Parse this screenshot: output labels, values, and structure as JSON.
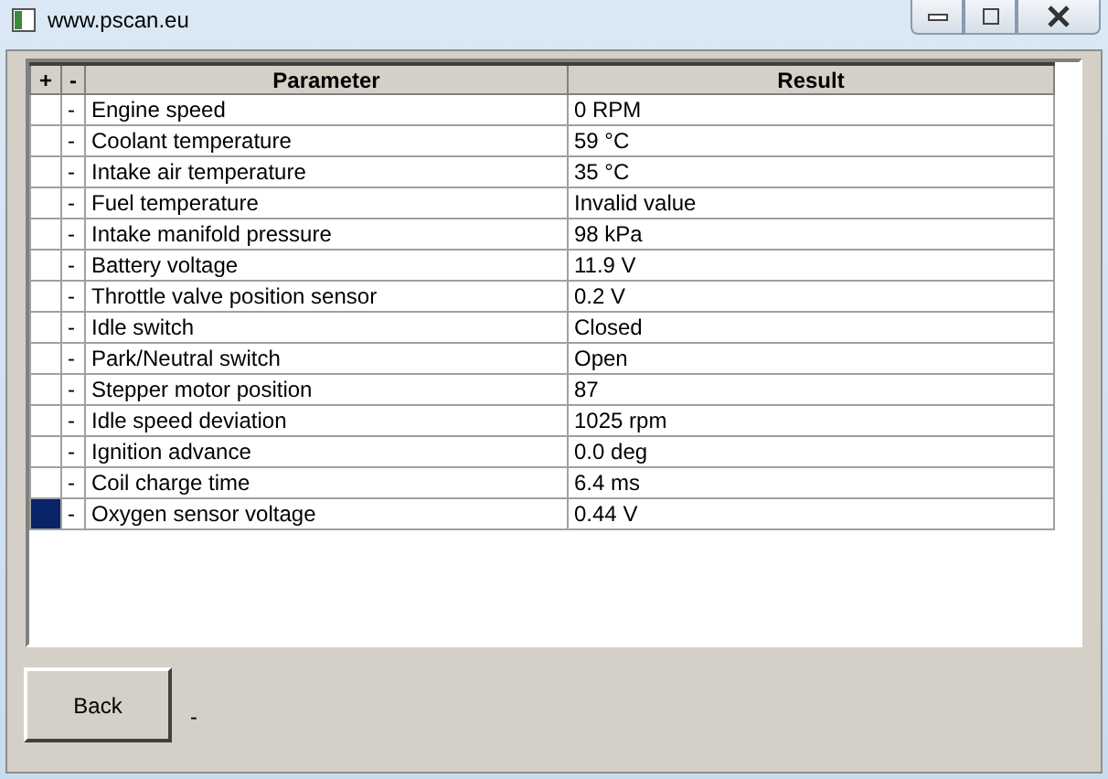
{
  "window": {
    "title": "www.pscan.eu"
  },
  "table": {
    "columns": [
      "+",
      "-",
      "Parameter",
      "Result"
    ],
    "rows": [
      {
        "marker": "-",
        "parameter": "Engine speed",
        "result": "0 RPM",
        "selected": false
      },
      {
        "marker": "-",
        "parameter": "Coolant temperature",
        "result": "59 °C",
        "selected": false
      },
      {
        "marker": "-",
        "parameter": "Intake air temperature",
        "result": "35 °C",
        "selected": false
      },
      {
        "marker": "-",
        "parameter": "Fuel temperature",
        "result": "Invalid value",
        "selected": false
      },
      {
        "marker": "-",
        "parameter": "Intake manifold pressure",
        "result": "98 kPa",
        "selected": false
      },
      {
        "marker": "-",
        "parameter": "Battery voltage",
        "result": "11.9 V",
        "selected": false
      },
      {
        "marker": "-",
        "parameter": "Throttle valve position sensor",
        "result": "0.2 V",
        "selected": false
      },
      {
        "marker": "-",
        "parameter": "Idle switch",
        "result": "Closed",
        "selected": false
      },
      {
        "marker": "-",
        "parameter": "Park/Neutral switch",
        "result": "Open",
        "selected": false
      },
      {
        "marker": "-",
        "parameter": "Stepper motor position",
        "result": "87",
        "selected": false
      },
      {
        "marker": "-",
        "parameter": "Idle speed deviation",
        "result": "1025 rpm",
        "selected": false
      },
      {
        "marker": "-",
        "parameter": "Ignition advance",
        "result": "0.0 deg",
        "selected": false
      },
      {
        "marker": "-",
        "parameter": "Coil charge time",
        "result": "6.4 ms",
        "selected": false
      },
      {
        "marker": "-",
        "parameter": "Oxygen sensor voltage",
        "result": "0.44 V",
        "selected": true
      }
    ]
  },
  "back_button": "Back",
  "status": "-"
}
